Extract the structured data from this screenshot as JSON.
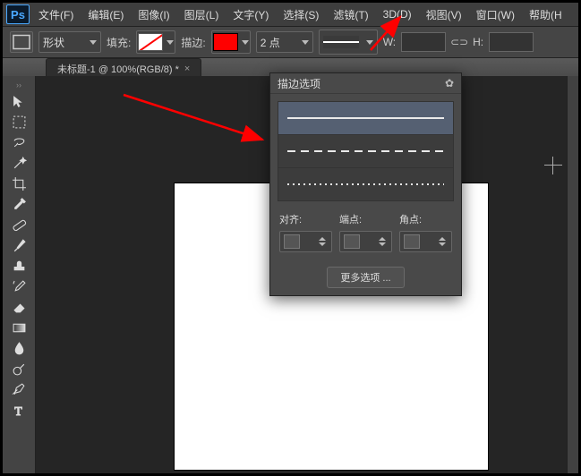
{
  "menu": {
    "file": "文件(F)",
    "edit": "编辑(E)",
    "image": "图像(I)",
    "layer": "图层(L)",
    "type": "文字(Y)",
    "select": "选择(S)",
    "filter": "滤镜(T)",
    "threeD": "3D(D)",
    "view": "视图(V)",
    "window": "窗口(W)",
    "help": "帮助(H"
  },
  "opt": {
    "mode_label": "形状",
    "fill_label": "填充:",
    "stroke_label": "描边:",
    "stroke_width": "2 点",
    "w_label": "W:",
    "h_label": "H:",
    "w_val": "",
    "h_val": ""
  },
  "tab": {
    "title": "未标题-1 @ 100%(RGB/8) *",
    "close": "×"
  },
  "panel": {
    "title": "描边选项",
    "align_label": "对齐:",
    "caps_label": "端点:",
    "corners_label": "角点:",
    "more_btn": "更多选项 ..."
  },
  "logo": "Ps",
  "icons": {
    "gear": "✿",
    "link": "⊂⊃",
    "tabbar_handle": "››"
  }
}
